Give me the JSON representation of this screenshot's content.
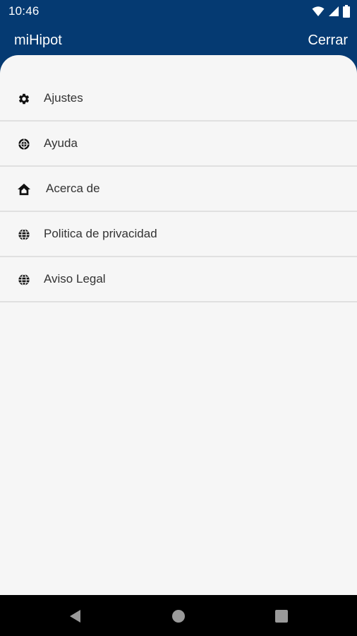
{
  "status_bar": {
    "time": "10:46",
    "icons": [
      "wifi-icon",
      "signal-icon",
      "battery-icon"
    ]
  },
  "header": {
    "title": "miHipot",
    "close_label": "Cerrar"
  },
  "menu": {
    "items": [
      {
        "label": "Ajustes",
        "icon": "gear-icon"
      },
      {
        "label": "Ayuda",
        "icon": "help-icon"
      },
      {
        "label": "Acerca de",
        "icon": "home-icon"
      },
      {
        "label": "Politica de privacidad",
        "icon": "globe-icon"
      },
      {
        "label": "Aviso Legal",
        "icon": "globe-icon"
      }
    ]
  },
  "nav": {
    "buttons": [
      "back-icon",
      "home-circle-icon",
      "recents-icon"
    ]
  },
  "colors": {
    "primary": "#053a72",
    "sheet_background": "#f6f6f6",
    "divider": "#e0e0e0",
    "text": "#333333"
  }
}
